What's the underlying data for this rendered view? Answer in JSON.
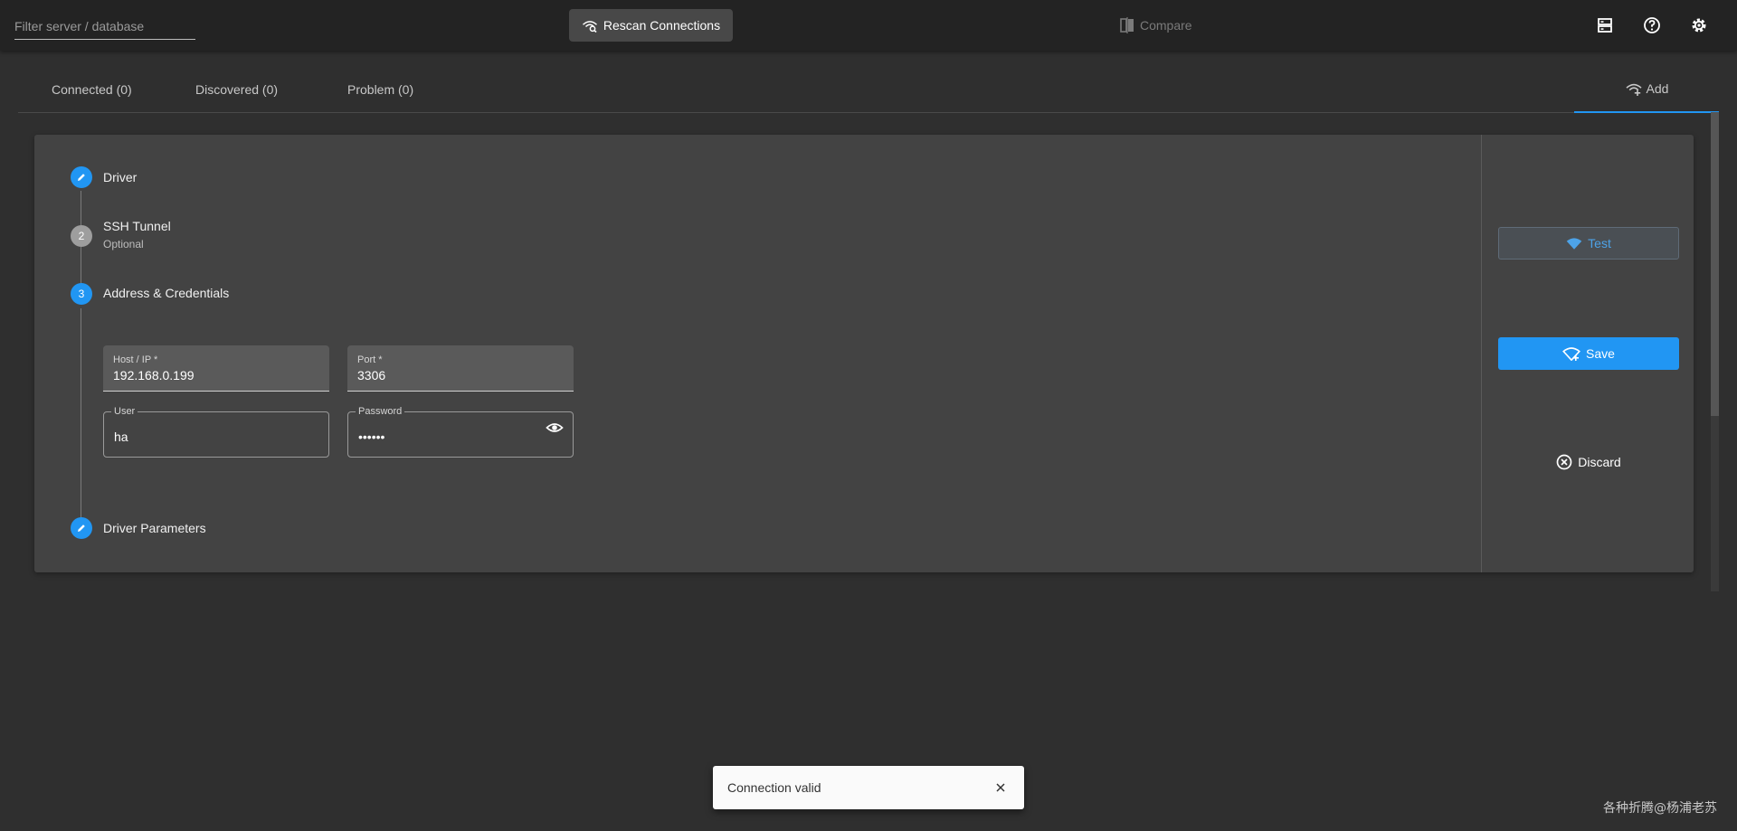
{
  "topbar": {
    "filter_placeholder": "Filter server / database",
    "rescan_label": "Rescan Connections",
    "compare_label": "Compare"
  },
  "tabs": {
    "connected": "Connected (0)",
    "discovered": "Discovered (0)",
    "problem": "Problem (0)",
    "add": "Add"
  },
  "steps": {
    "driver": "Driver",
    "ssh_number": "2",
    "ssh_title": "SSH Tunnel",
    "ssh_sub": "Optional",
    "address_number": "3",
    "address_title": "Address & Credentials",
    "driver_params": "Driver Parameters"
  },
  "form": {
    "host_label": "Host / IP *",
    "host_value": "192.168.0.199",
    "port_label": "Port *",
    "port_value": "3306",
    "user_label": "User",
    "user_value": "ha",
    "password_label": "Password",
    "password_value": "••••••"
  },
  "actions": {
    "test_label": "Test",
    "save_label": "Save",
    "discard_label": "Discard"
  },
  "snackbar": {
    "message": "Connection valid"
  },
  "watermark": "各种折腾@杨浦老苏",
  "colors": {
    "accent": "#2196f3",
    "background": "#2f2f2f",
    "card": "#434343",
    "topbar": "#232323"
  }
}
